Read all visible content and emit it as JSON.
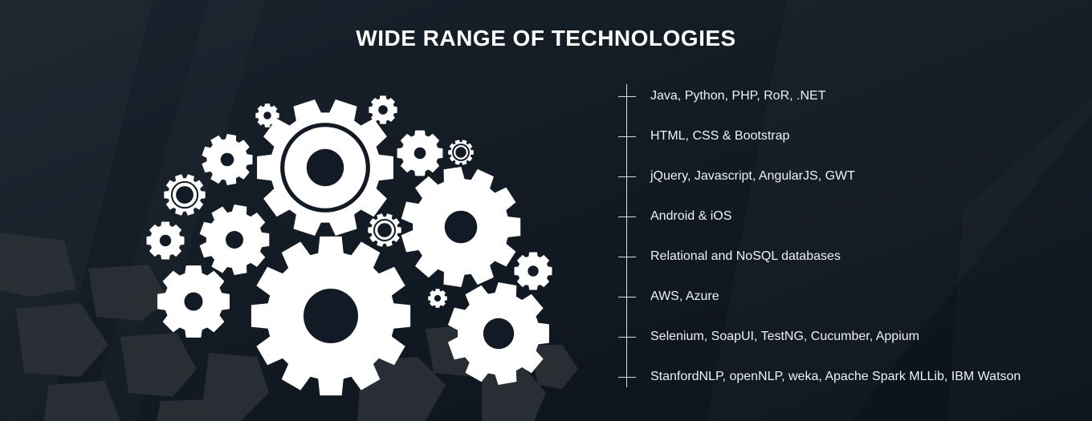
{
  "title": "WIDE RANGE OF TECHNOLOGIES",
  "colors": {
    "background": "#121a25",
    "gear": "#ffffff",
    "text": "#eef1f5",
    "timeline": "#d9dde3",
    "hexagon_pattern": "#2c3037"
  },
  "illustration": {
    "icon": "gears-cluster-icon"
  },
  "technologies": [
    {
      "label": "Java, Python, PHP, RoR, .NET"
    },
    {
      "label": "HTML, CSS & Bootstrap"
    },
    {
      "label": "jQuery, Javascript, AngularJS, GWT"
    },
    {
      "label": "Android & iOS"
    },
    {
      "label": "Relational and NoSQL databases"
    },
    {
      "label": "AWS, Azure"
    },
    {
      "label": "Selenium, SoapUI, TestNG, Cucumber, Appium"
    },
    {
      "label": "StanfordNLP, openNLP, weka, Apache Spark MLLib, IBM Watson"
    }
  ]
}
